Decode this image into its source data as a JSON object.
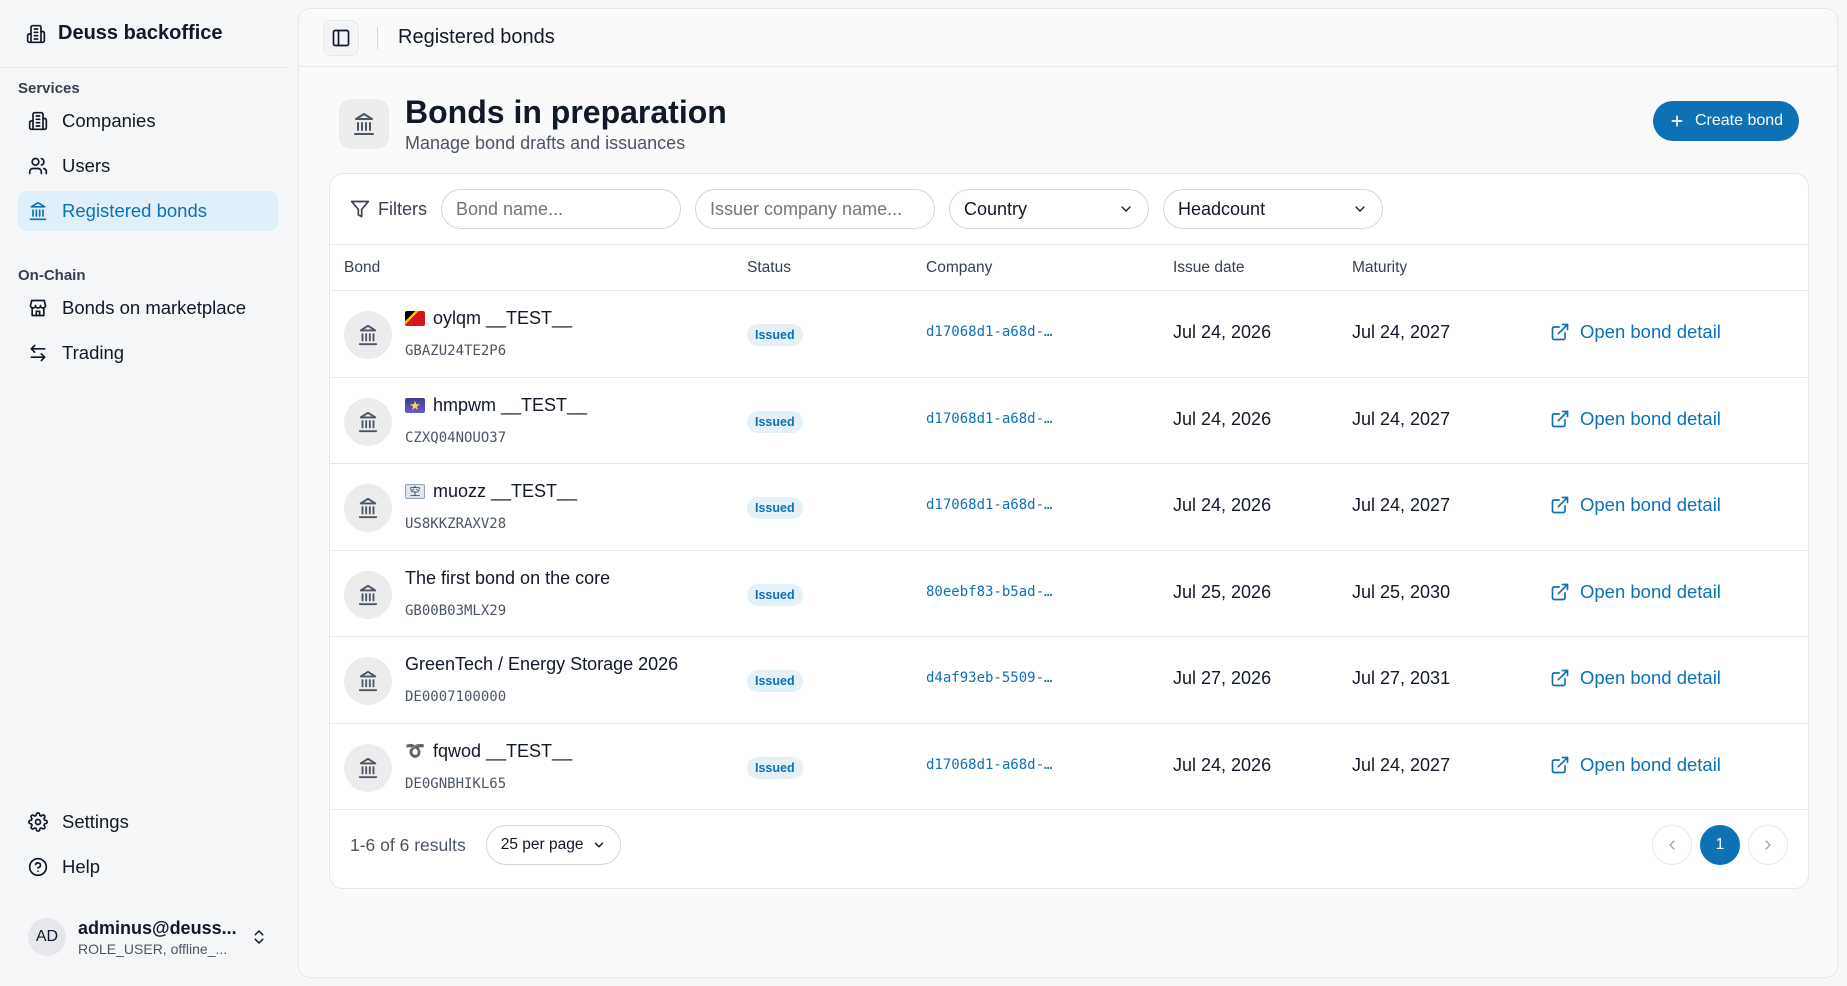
{
  "app": {
    "brand": "Deuss backoffice"
  },
  "sidebar": {
    "groups": [
      {
        "label": "Services",
        "items": [
          {
            "label": "Companies",
            "icon": "building-icon",
            "active": false
          },
          {
            "label": "Users",
            "icon": "users-icon",
            "active": false
          },
          {
            "label": "Registered bonds",
            "icon": "bank-icon",
            "active": true
          }
        ]
      },
      {
        "label": "On-Chain",
        "items": [
          {
            "label": "Bonds on marketplace",
            "icon": "store-icon",
            "active": false
          },
          {
            "label": "Trading",
            "icon": "arrows-icon",
            "active": false
          }
        ]
      }
    ],
    "bottom": [
      {
        "label": "Settings",
        "icon": "gear-icon"
      },
      {
        "label": "Help",
        "icon": "help-icon"
      }
    ],
    "user": {
      "initials": "AD",
      "email": "adminus@deuss...",
      "role": "ROLE_USER, offline_..."
    }
  },
  "topbar": {
    "title": "Registered bonds"
  },
  "page": {
    "title": "Bonds in preparation",
    "subtitle": "Manage bond drafts and issuances",
    "create_label": "Create bond"
  },
  "filters": {
    "label": "Filters",
    "bond_name_placeholder": "Bond name...",
    "issuer_placeholder": "Issuer company name...",
    "country_label": "Country",
    "headcount_label": "Headcount"
  },
  "table": {
    "columns": [
      "Bond",
      "Status",
      "Company",
      "Issue date",
      "Maturity"
    ],
    "link_label": "Open bond detail",
    "rows": [
      {
        "flag": "tl",
        "name": "oylqm __TEST__",
        "code": "GBAZU24TE2P6",
        "status": "Issued",
        "company": "d17068d1-a68d-…",
        "issue_date": "Jul 24, 2026",
        "maturity": "Jul 24, 2027"
      },
      {
        "flag": "night",
        "name": "hmpwm __TEST__",
        "code": "CZXQ04NOUO37",
        "status": "Issued",
        "company": "d17068d1-a68d-…",
        "issue_date": "Jul 24, 2026",
        "maturity": "Jul 24, 2027"
      },
      {
        "flag": "kanji",
        "name": "muozz __TEST__",
        "code": "US8KKZRAXV28",
        "status": "Issued",
        "company": "d17068d1-a68d-…",
        "issue_date": "Jul 24, 2026",
        "maturity": "Jul 24, 2027"
      },
      {
        "flag": "",
        "name": "The first bond on the core",
        "code": "GB00B03MLX29",
        "status": "Issued",
        "company": "80eebf83-b5ad-…",
        "issue_date": "Jul 25, 2026",
        "maturity": "Jul 25, 2030"
      },
      {
        "flag": "",
        "name": "GreenTech / Energy Storage 2026",
        "code": "DE0007100000",
        "status": "Issued",
        "company": "d4af93eb-5509-…",
        "issue_date": "Jul 27, 2026",
        "maturity": "Jul 27, 2031"
      },
      {
        "flag": "curly",
        "name": "fqwod __TEST__",
        "code": "DE0GNBHIKL65",
        "status": "Issued",
        "company": "d17068d1-a68d-…",
        "issue_date": "Jul 24, 2026",
        "maturity": "Jul 24, 2027"
      }
    ]
  },
  "pagination": {
    "results_text": "1-6 of 6 results",
    "per_page_label": "25 per page",
    "current_page": "1"
  },
  "colors": {
    "accent": "#0c71b5",
    "accent_light": "#e0f0fa"
  }
}
